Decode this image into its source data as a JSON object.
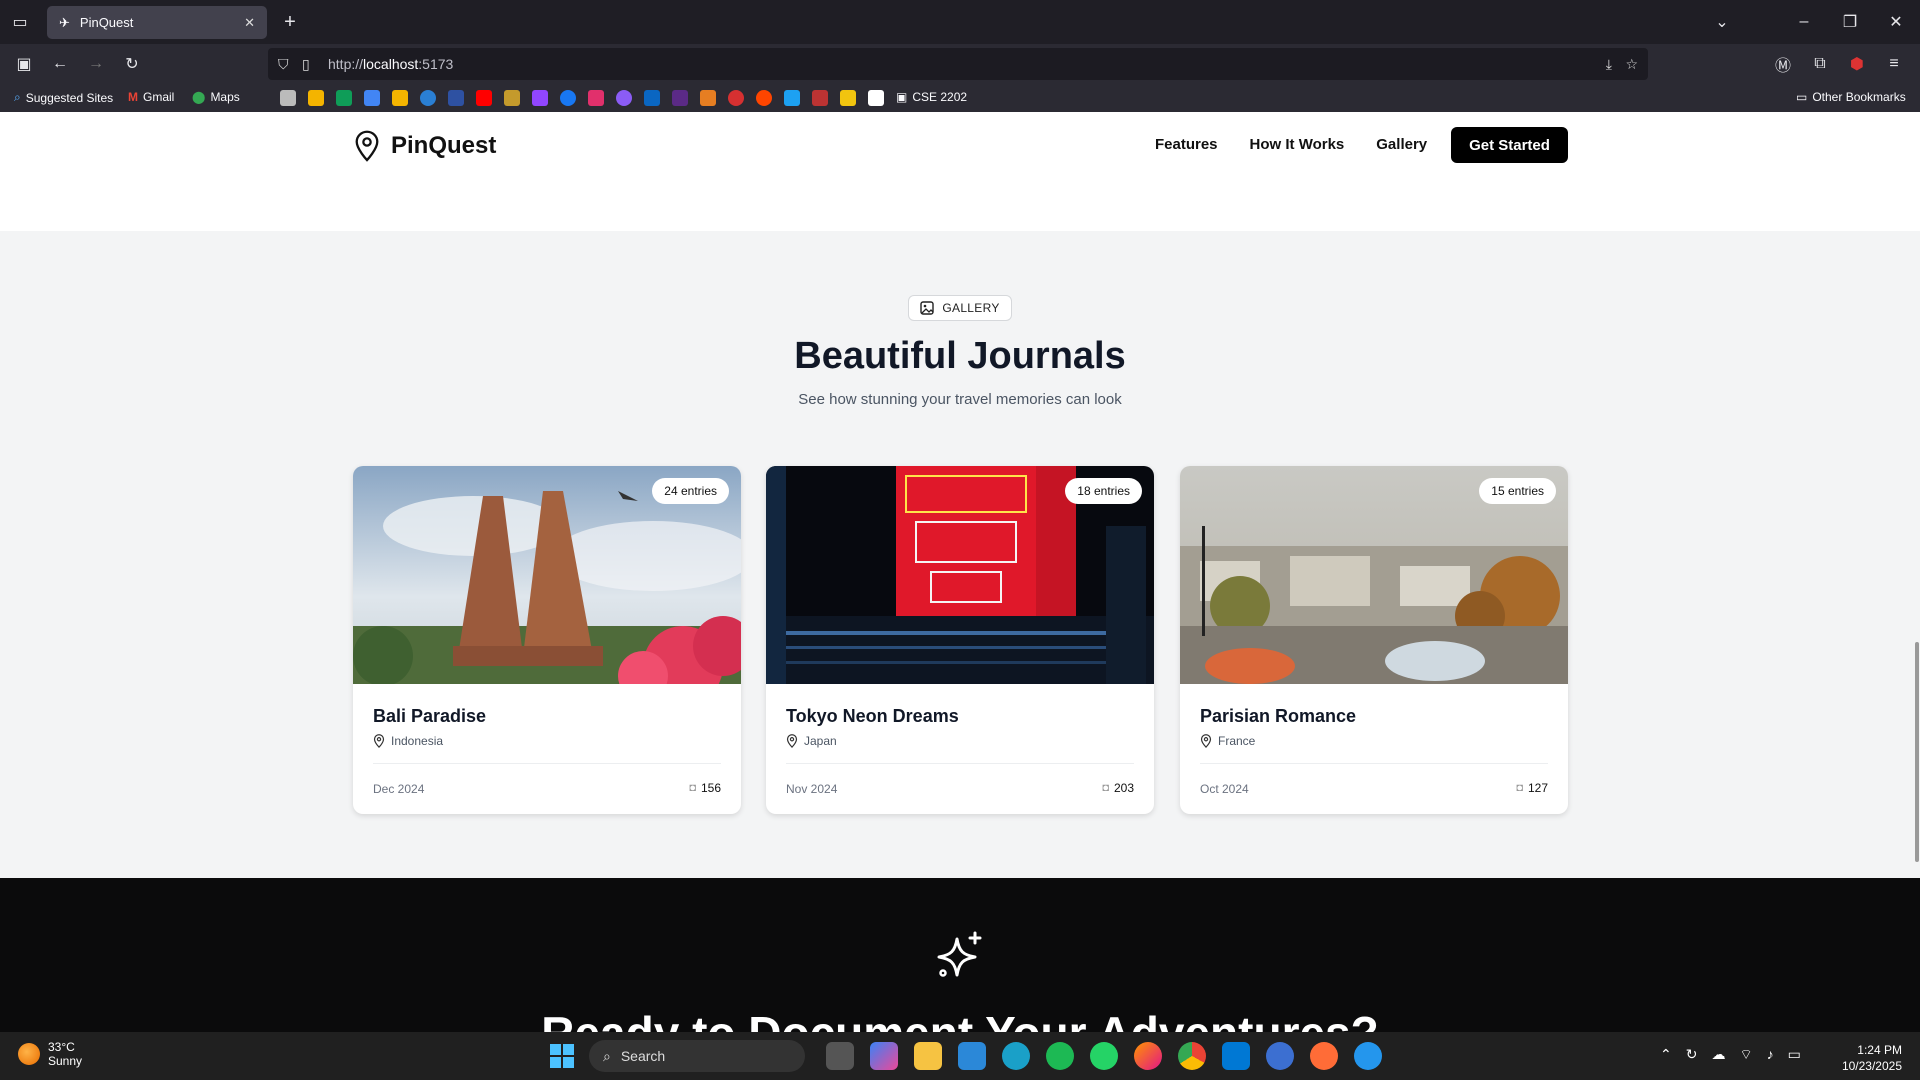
{
  "browser": {
    "tab_title": "PinQuest",
    "url_prefix": "http://",
    "url_host": "localhost",
    "url_port": ":5173",
    "bookmarks": {
      "suggested": "Suggested Sites",
      "gmail": "Gmail",
      "maps": "Maps",
      "cse": "CSE 2202",
      "other": "Other Bookmarks"
    }
  },
  "site": {
    "logo_text": "PinQuest",
    "nav": {
      "features": "Features",
      "how_it_works": "How It Works",
      "gallery": "Gallery"
    },
    "cta_label": "Get Started"
  },
  "gallery": {
    "pill_label": "GALLERY",
    "title": "Beautiful Journals",
    "subtitle": "See how stunning your travel memories can look",
    "cards": [
      {
        "title": "Bali Paradise",
        "location": "Indonesia",
        "entries": "24 entries",
        "date": "Dec 2024",
        "views": "156"
      },
      {
        "title": "Tokyo Neon Dreams",
        "location": "Japan",
        "entries": "18 entries",
        "date": "Nov 2024",
        "views": "203"
      },
      {
        "title": "Parisian Romance",
        "location": "France",
        "entries": "15 entries",
        "date": "Oct 2024",
        "views": "127"
      }
    ]
  },
  "cta_section": {
    "heading": "Ready to Document Your Adventures?"
  },
  "taskbar": {
    "temp": "33°C",
    "condition": "Sunny",
    "search": "Search",
    "time": "1:24 PM",
    "date": "10/23/2025"
  }
}
